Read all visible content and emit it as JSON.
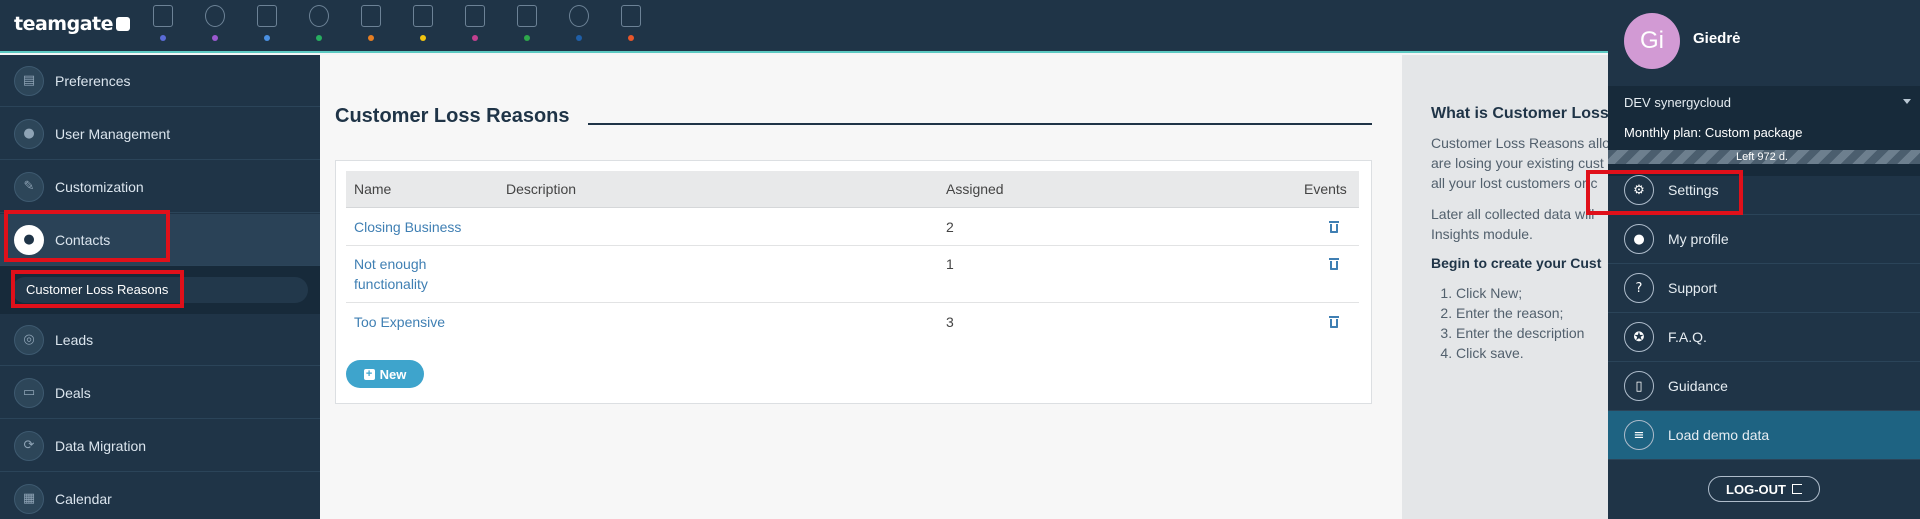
{
  "app": {
    "logo_text": "teamgate"
  },
  "topbar": {
    "modules": [
      {
        "icon": "dashboard-icon",
        "dot": "#5a6bd6"
      },
      {
        "icon": "target-icon",
        "dot": "#9b59d0"
      },
      {
        "icon": "companies-icon",
        "dot": "#4a90e2"
      },
      {
        "icon": "people-icon",
        "dot": "#27ae60"
      },
      {
        "icon": "deals-icon",
        "dot": "#e67e22"
      },
      {
        "icon": "calendar-icon",
        "dot": "#f1c40f"
      },
      {
        "icon": "download-icon",
        "dot": "#c2408f"
      },
      {
        "icon": "invoice-icon",
        "dot": "#2ea84b"
      },
      {
        "icon": "insights-icon",
        "dot": "#1f5fa8"
      },
      {
        "icon": "reports-icon",
        "dot": "#e8562a"
      }
    ]
  },
  "sidebar": {
    "items": [
      {
        "label": "Preferences",
        "icon": "preferences-icon"
      },
      {
        "label": "User Management",
        "icon": "users-icon"
      },
      {
        "label": "Customization",
        "icon": "wrench-icon"
      },
      {
        "label": "Contacts",
        "icon": "person-icon"
      },
      {
        "label": "Leads",
        "icon": "target-icon"
      },
      {
        "label": "Deals",
        "icon": "briefcase-icon"
      },
      {
        "label": "Data Migration",
        "icon": "sync-icon"
      },
      {
        "label": "Calendar",
        "icon": "calendar-icon"
      }
    ],
    "sub_item": "Customer Loss Reasons"
  },
  "main": {
    "title": "Customer Loss Reasons",
    "columns": [
      "Name",
      "Description",
      "Assigned",
      "Events"
    ],
    "rows": [
      {
        "name": "Closing Business",
        "name_line2": "",
        "description": "",
        "assigned": "2"
      },
      {
        "name": "Not enough",
        "name_line2": "functionality",
        "description": "",
        "assigned": "1"
      },
      {
        "name": "Too Expensive",
        "name_line2": "",
        "description": "",
        "assigned": "3"
      }
    ],
    "new_button": "New"
  },
  "help": {
    "title": "What is Customer Loss",
    "para1": [
      "Customer Loss Reasons allo",
      "are losing your existing cust",
      "all your lost customers or c"
    ],
    "para2": [
      "Later all collected data will",
      "Insights module."
    ],
    "begin": "Begin to create your Cust",
    "steps": [
      "Click New;",
      "Enter the reason;",
      "Enter the description",
      "Click save."
    ]
  },
  "profile": {
    "initials": "Gi",
    "name": "Giedrė",
    "organization": "DEV synergycloud",
    "plan": "Monthly plan: Custom package",
    "trial_left": "Left 972 d.",
    "menu": [
      {
        "label": "Settings",
        "icon": "gear-icon"
      },
      {
        "label": "My profile",
        "icon": "profile-icon"
      },
      {
        "label": "Support",
        "icon": "question-icon"
      },
      {
        "label": "F.A.Q.",
        "icon": "lifebuoy-icon"
      },
      {
        "label": "Guidance",
        "icon": "book-icon"
      },
      {
        "label": "Load demo data",
        "icon": "database-icon"
      }
    ],
    "logout": "LOG-OUT"
  },
  "colors": {
    "nav_bg": "#1f3447",
    "accent": "#5cc9c2",
    "link": "#3f7fb3",
    "button": "#3ea4cc",
    "highlight": "#1e6382",
    "annotation": "#e0101a"
  }
}
